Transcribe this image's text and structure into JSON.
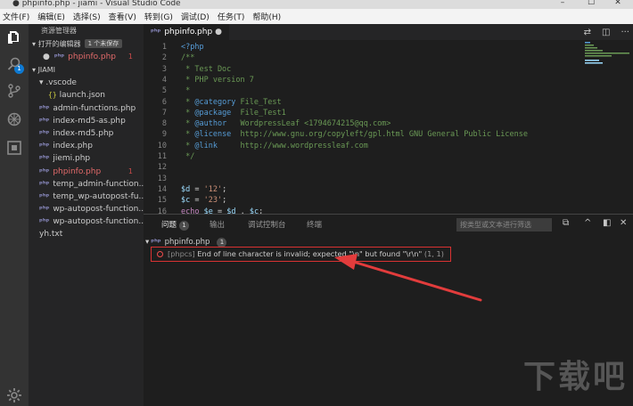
{
  "window": {
    "title": "● phpinfo.php - jiami - Visual Studio Code",
    "controls": [
      "–",
      "☐",
      "✕"
    ]
  },
  "menu": [
    "文件(F)",
    "编辑(E)",
    "选择(S)",
    "查看(V)",
    "转到(G)",
    "调试(D)",
    "任务(T)",
    "帮助(H)"
  ],
  "activity": {
    "items": [
      "files-icon",
      "search-icon",
      "source-control-icon",
      "debug-icon",
      "extensions-icon",
      "settings-icon"
    ],
    "badge": "1"
  },
  "sidebar": {
    "title": "资源管理器",
    "open_editors": {
      "label": "打开的编辑器",
      "pill": "1 个未保存",
      "file": {
        "dot": "●",
        "name": "phpinfo.php",
        "count": "1"
      }
    },
    "folder": "JIAMI",
    "items": [
      {
        "label": "▾ .vscode",
        "indent": 1,
        "type": "folder"
      },
      {
        "label": "launch.json",
        "indent": 2,
        "type": "json"
      },
      {
        "label": "admin-functions.php",
        "indent": 1,
        "type": "php"
      },
      {
        "label": "index-md5-as.php",
        "indent": 1,
        "type": "php"
      },
      {
        "label": "index-md5.php",
        "indent": 1,
        "type": "php"
      },
      {
        "label": "index.php",
        "indent": 1,
        "type": "php"
      },
      {
        "label": "jiemi.php",
        "indent": 1,
        "type": "php"
      },
      {
        "label": "phpinfo.php",
        "indent": 1,
        "type": "php",
        "error": true,
        "count": "1"
      },
      {
        "label": "temp_admin-function...",
        "indent": 1,
        "type": "php"
      },
      {
        "label": "temp_wp-autopost-fu...",
        "indent": 1,
        "type": "php"
      },
      {
        "label": "wp-autopost-function...",
        "indent": 1,
        "type": "php"
      },
      {
        "label": "wp-autopost-function...",
        "indent": 1,
        "type": "php"
      },
      {
        "label": "yh.txt",
        "indent": 1,
        "type": "txt"
      }
    ]
  },
  "editor": {
    "tab": "phpinfo.php",
    "lines": [
      {
        "n": "1",
        "tokens": [
          [
            "tag",
            "<?php"
          ]
        ]
      },
      {
        "n": "2",
        "tokens": [
          [
            "cmt",
            "/**"
          ]
        ]
      },
      {
        "n": "3",
        "tokens": [
          [
            "cmt",
            " * Test Doc"
          ]
        ]
      },
      {
        "n": "4",
        "tokens": [
          [
            "cmt",
            " * PHP version 7"
          ]
        ]
      },
      {
        "n": "5",
        "tokens": [
          [
            "cmt",
            " *"
          ]
        ]
      },
      {
        "n": "6",
        "tokens": [
          [
            "cmt",
            " * "
          ],
          [
            "tag",
            "@category"
          ],
          [
            "cmt",
            " File_Test"
          ]
        ]
      },
      {
        "n": "7",
        "tokens": [
          [
            "cmt",
            " * "
          ],
          [
            "tag",
            "@package"
          ],
          [
            "cmt",
            "  File_Test1"
          ]
        ]
      },
      {
        "n": "8",
        "tokens": [
          [
            "cmt",
            " * "
          ],
          [
            "tag",
            "@author"
          ],
          [
            "cmt",
            "   WordpressLeaf <1794674215@qq.com>"
          ]
        ]
      },
      {
        "n": "9",
        "tokens": [
          [
            "cmt",
            " * "
          ],
          [
            "tag",
            "@license"
          ],
          [
            "cmt",
            "  http://www.gnu.org/copyleft/gpl.html GNU General Public License"
          ]
        ]
      },
      {
        "n": "10",
        "tokens": [
          [
            "cmt",
            " * "
          ],
          [
            "tag",
            "@link"
          ],
          [
            "cmt",
            "     http://www.wordpressleaf.com"
          ]
        ]
      },
      {
        "n": "11",
        "tokens": [
          [
            "cmt",
            " */"
          ]
        ]
      },
      {
        "n": "12",
        "tokens": []
      },
      {
        "n": "13",
        "tokens": []
      },
      {
        "n": "14",
        "tokens": [
          [
            "var",
            "$d"
          ],
          [
            "plain",
            " = "
          ],
          [
            "str",
            "'12'"
          ],
          [
            "plain",
            ";"
          ]
        ]
      },
      {
        "n": "15",
        "tokens": [
          [
            "var",
            "$c"
          ],
          [
            "plain",
            " = "
          ],
          [
            "str",
            "'23'"
          ],
          [
            "plain",
            ";"
          ]
        ]
      },
      {
        "n": "16",
        "tokens": [
          [
            "kw",
            "echo"
          ],
          [
            "plain",
            " "
          ],
          [
            "var",
            "$e"
          ],
          [
            "plain",
            " = "
          ],
          [
            "var",
            "$d"
          ],
          [
            "plain",
            " . "
          ],
          [
            "var",
            "$c"
          ],
          [
            "plain",
            ";"
          ]
        ]
      }
    ]
  },
  "panel": {
    "tabs": [
      {
        "label": "问题",
        "badge": "1",
        "active": true
      },
      {
        "label": "输出"
      },
      {
        "label": "调试控制台"
      },
      {
        "label": "终端"
      }
    ],
    "filter_placeholder": "按类型或文本进行筛选",
    "actions": [
      "copy-icon",
      "chevron-up-icon",
      "maximize-icon",
      "close-icon"
    ],
    "file": {
      "name": "phpinfo.php",
      "count": "1"
    },
    "problem": {
      "source": "[phpcs]",
      "message": "End of line character is invalid; expected \"\\n\" but found \"\\r\\n\"",
      "position": "(1, 1)"
    }
  },
  "accent": {
    "error": "#f14c4c",
    "highlight": "#d93232",
    "badge": "#0e7ad3"
  }
}
